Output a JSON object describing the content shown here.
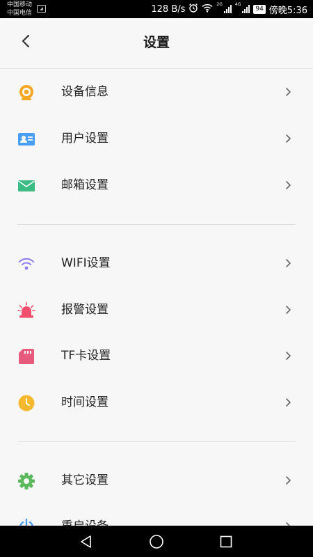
{
  "status_bar": {
    "carrier_1": "中国移动",
    "carrier_2": "中国电信",
    "speed": "128 B/s",
    "net_1": "2G",
    "net_2": "4G",
    "battery": "94",
    "time": "傍晚5:36"
  },
  "header": {
    "title": "设置"
  },
  "groups": [
    {
      "items": [
        {
          "label": "设备信息",
          "icon": "camera-icon",
          "color": "#f5a623"
        },
        {
          "label": "用户设置",
          "icon": "id-card-icon",
          "color": "#4a9ff5"
        },
        {
          "label": "邮箱设置",
          "icon": "mail-icon",
          "color": "#3dbb84"
        }
      ]
    },
    {
      "items": [
        {
          "label": "WIFI设置",
          "icon": "wifi-icon",
          "color": "#8d7df0"
        },
        {
          "label": "报警设置",
          "icon": "alarm-siren-icon",
          "color": "#f0506e"
        },
        {
          "label": "TF卡设置",
          "icon": "sd-card-icon",
          "color": "#e85a7d"
        },
        {
          "label": "时间设置",
          "icon": "clock-icon",
          "color": "#f5b82e"
        }
      ]
    },
    {
      "items": [
        {
          "label": "其它设置",
          "icon": "gear-icon",
          "color": "#5cb85c"
        },
        {
          "label": "重启设备",
          "icon": "power-icon",
          "color": "#4a9ff5"
        }
      ]
    }
  ]
}
